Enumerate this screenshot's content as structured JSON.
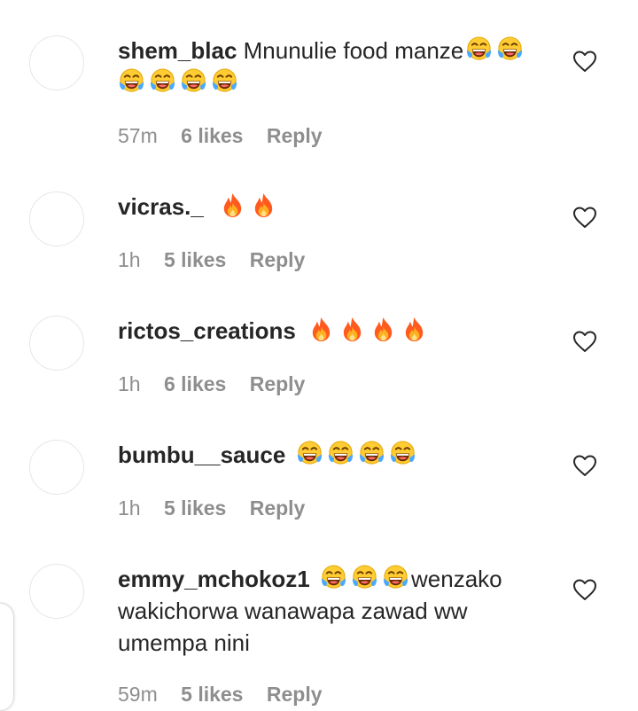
{
  "comments": [
    {
      "username": "shem_blac",
      "text": "Mnunulie food manze",
      "emojis_inline": [
        "laugh-cry",
        "laugh-cry"
      ],
      "emojis_line2": [
        "laugh-cry",
        "laugh-cry",
        "laugh-cry",
        "laugh-cry"
      ],
      "time": "57m",
      "likes": "6 likes",
      "reply": "Reply"
    },
    {
      "username": "vicras._",
      "emojis": [
        "fire",
        "fire"
      ],
      "time": "1h",
      "likes": "5 likes",
      "reply": "Reply"
    },
    {
      "username": "rictos_creations",
      "emojis": [
        "fire",
        "fire",
        "fire",
        "fire"
      ],
      "time": "1h",
      "likes": "6 likes",
      "reply": "Reply"
    },
    {
      "username": "bumbu__sauce",
      "emojis": [
        "laugh-cry",
        "laugh-cry",
        "laugh-cry",
        "laugh-cry"
      ],
      "time": "1h",
      "likes": "5 likes",
      "reply": "Reply"
    },
    {
      "username": "emmy_mchokoz1",
      "emojis": [
        "laugh-cry",
        "laugh-cry",
        "laugh-cry"
      ],
      "text": "wenzako wakichorwa wanawapa zawad ww umempa nini",
      "time": "59m",
      "likes": "5 likes",
      "reply": "Reply"
    }
  ],
  "colors": {
    "text": "#262626",
    "meta": "#8e8e8e",
    "avatar_border": "#e6e6e6",
    "background": "#ffffff"
  }
}
